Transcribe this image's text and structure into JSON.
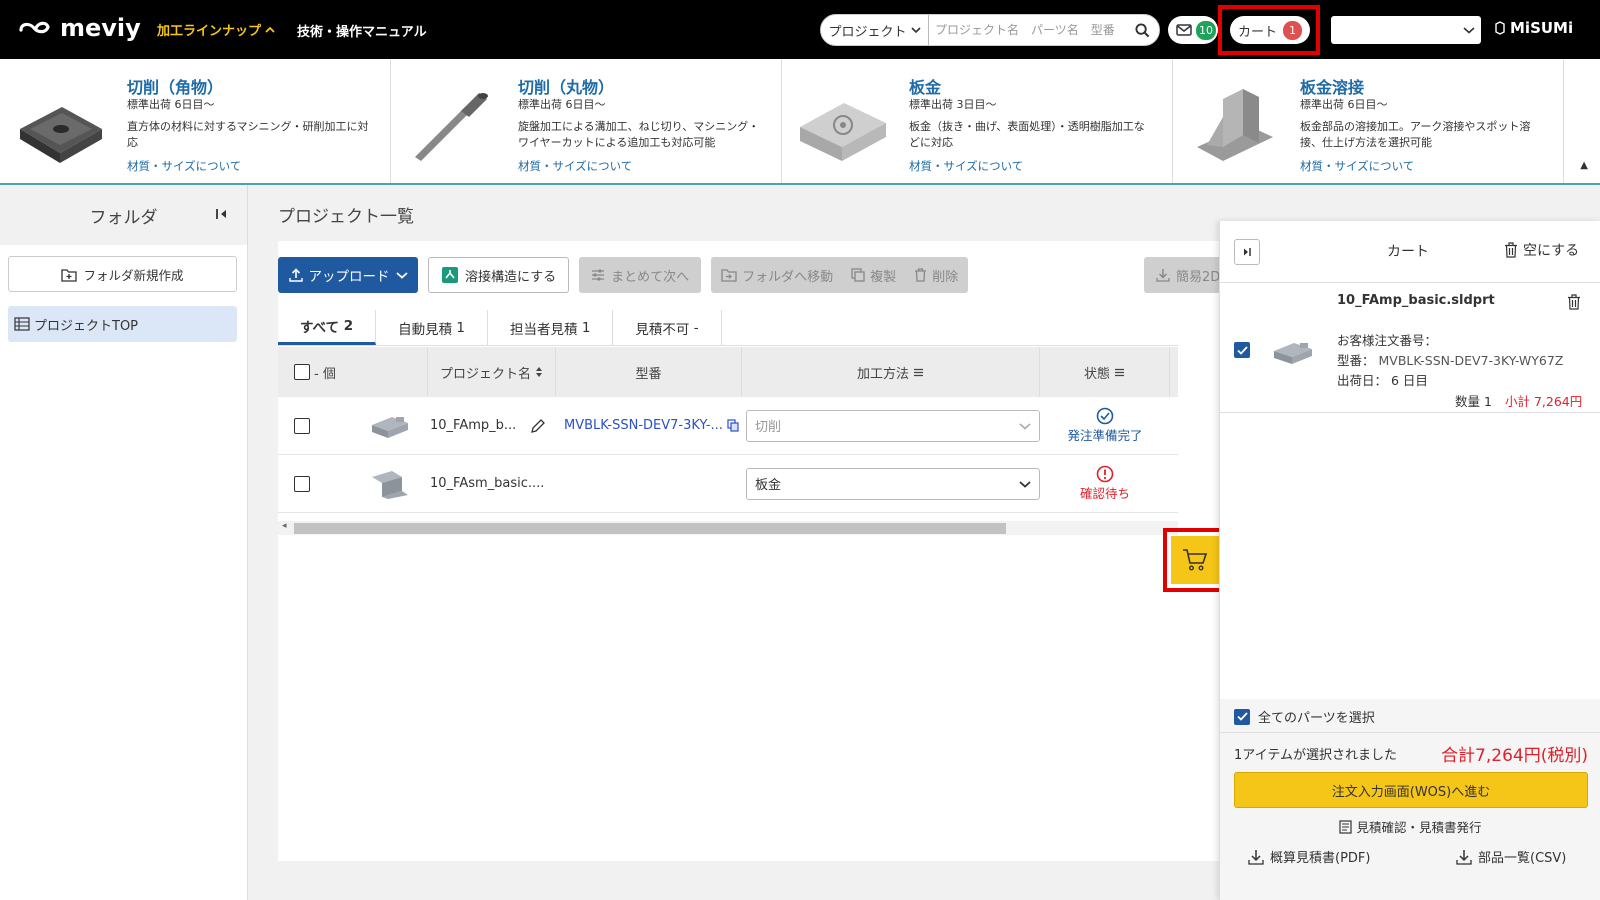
{
  "header": {
    "logo": "meviy",
    "lineup_label": "加工ラインナップ",
    "manual_label": "技術・操作マニュアル",
    "search_scope": "プロジェクト",
    "search_placeholder": "プロジェクト名　パーツ名　型番",
    "mail_count": "10",
    "cart_label": "カート",
    "cart_count": "1",
    "brand": "MiSUMi",
    "accent": "#f5c518"
  },
  "lineup": [
    {
      "title": "切削（角物）",
      "lead": "標準出荷 6日目～",
      "desc": "直方体の材料に対するマシニング・研削加工に対応",
      "link": "材質・サイズについて"
    },
    {
      "title": "切削（丸物）",
      "lead": "標準出荷 6日目～",
      "desc": "旋盤加工による溝加工、ねじ切り、マシニング・ワイヤーカットによる追加工も対応可能",
      "link": "材質・サイズについて"
    },
    {
      "title": "板金",
      "lead": "標準出荷 3日目～",
      "desc": "板金（抜き・曲げ、表面処理）・透明樹脂加工などに対応",
      "link": "材質・サイズについて"
    },
    {
      "title": "板金溶接",
      "lead": "標準出荷 6日目～",
      "desc": "板金部品の溶接加工。アーク溶接やスポット溶接、仕上げ方法を選択可能",
      "link": "材質・サイズについて"
    }
  ],
  "folder": {
    "title": "フォルダ",
    "new_folder": "フォルダ新規作成",
    "project_top": "プロジェクトTOP"
  },
  "main": {
    "title": "プロジェクト一覧",
    "toolbar": {
      "upload": "アップロード",
      "weld": "溶接構造にする",
      "batch_next": "まとめて次へ",
      "move_folder": "フォルダへ移動",
      "copy": "複製",
      "delete": "削除",
      "simple": "簡易2D"
    },
    "tabs": [
      {
        "label": "すべて",
        "count": "2"
      },
      {
        "label": "自動見積",
        "count": "1"
      },
      {
        "label": "担当者見積",
        "count": "1"
      },
      {
        "label": "見積不可",
        "count": "-"
      }
    ],
    "columns": {
      "count": "- 個",
      "project_name": "プロジェクト名",
      "model": "型番",
      "method": "加工方法",
      "status": "状態"
    },
    "rows": [
      {
        "name": "10_FAmp_b...",
        "model": "MVBLK-SSN-DEV7-3KY-...",
        "method": "切削",
        "status": "発注準備完了",
        "status_color": "#1f5aa0"
      },
      {
        "name": "10_FAsm_basic....",
        "model": "",
        "method": "板金",
        "status": "確認待ち",
        "status_color": "#e0202a"
      }
    ]
  },
  "cart": {
    "title": "カート",
    "empty": "空にする",
    "item": {
      "name": "10_FAmp_basic.sldprt",
      "order_no_label": "お客様注文番号：",
      "model_label": "型番：",
      "model": "MVBLK-SSN-DEV7-3KY-WY67Z",
      "ship_label": "出荷日：",
      "ship": "6 日目",
      "qty": "数量 1",
      "subtotal": "小計 7,264円"
    },
    "select_all": "全てのパーツを選択",
    "selected_text": "1アイテムが選択されました",
    "total": "合計7,264円(税別)",
    "order_button": "注文入力画面(WOS)へ進む",
    "quote": "見積確認・見積書発行",
    "download_pdf": "概算見積書(PDF)",
    "download_csv": "部品一覧(CSV)"
  }
}
